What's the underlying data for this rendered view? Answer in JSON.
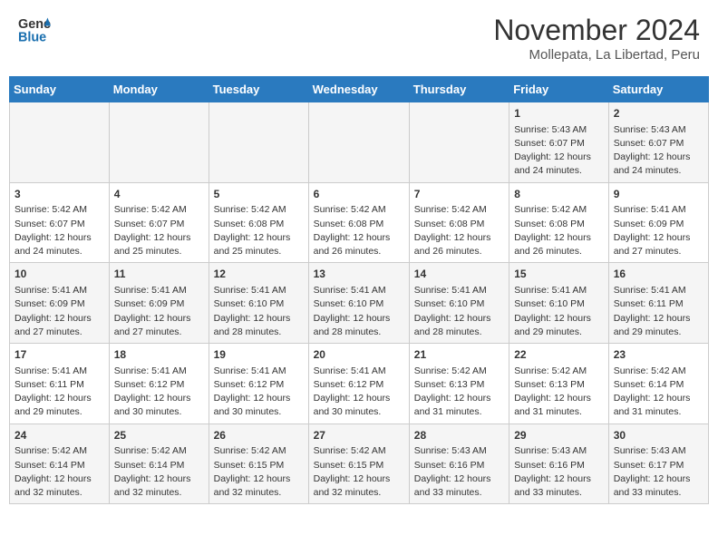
{
  "header": {
    "logo_line1": "General",
    "logo_line2": "Blue",
    "title": "November 2024",
    "subtitle": "Mollepata, La Libertad, Peru"
  },
  "days_of_week": [
    "Sunday",
    "Monday",
    "Tuesday",
    "Wednesday",
    "Thursday",
    "Friday",
    "Saturday"
  ],
  "weeks": [
    [
      {
        "day": "",
        "info": ""
      },
      {
        "day": "",
        "info": ""
      },
      {
        "day": "",
        "info": ""
      },
      {
        "day": "",
        "info": ""
      },
      {
        "day": "",
        "info": ""
      },
      {
        "day": "1",
        "info": "Sunrise: 5:43 AM\nSunset: 6:07 PM\nDaylight: 12 hours and 24 minutes."
      },
      {
        "day": "2",
        "info": "Sunrise: 5:43 AM\nSunset: 6:07 PM\nDaylight: 12 hours and 24 minutes."
      }
    ],
    [
      {
        "day": "3",
        "info": "Sunrise: 5:42 AM\nSunset: 6:07 PM\nDaylight: 12 hours and 24 minutes."
      },
      {
        "day": "4",
        "info": "Sunrise: 5:42 AM\nSunset: 6:07 PM\nDaylight: 12 hours and 25 minutes."
      },
      {
        "day": "5",
        "info": "Sunrise: 5:42 AM\nSunset: 6:08 PM\nDaylight: 12 hours and 25 minutes."
      },
      {
        "day": "6",
        "info": "Sunrise: 5:42 AM\nSunset: 6:08 PM\nDaylight: 12 hours and 26 minutes."
      },
      {
        "day": "7",
        "info": "Sunrise: 5:42 AM\nSunset: 6:08 PM\nDaylight: 12 hours and 26 minutes."
      },
      {
        "day": "8",
        "info": "Sunrise: 5:42 AM\nSunset: 6:08 PM\nDaylight: 12 hours and 26 minutes."
      },
      {
        "day": "9",
        "info": "Sunrise: 5:41 AM\nSunset: 6:09 PM\nDaylight: 12 hours and 27 minutes."
      }
    ],
    [
      {
        "day": "10",
        "info": "Sunrise: 5:41 AM\nSunset: 6:09 PM\nDaylight: 12 hours and 27 minutes."
      },
      {
        "day": "11",
        "info": "Sunrise: 5:41 AM\nSunset: 6:09 PM\nDaylight: 12 hours and 27 minutes."
      },
      {
        "day": "12",
        "info": "Sunrise: 5:41 AM\nSunset: 6:10 PM\nDaylight: 12 hours and 28 minutes."
      },
      {
        "day": "13",
        "info": "Sunrise: 5:41 AM\nSunset: 6:10 PM\nDaylight: 12 hours and 28 minutes."
      },
      {
        "day": "14",
        "info": "Sunrise: 5:41 AM\nSunset: 6:10 PM\nDaylight: 12 hours and 28 minutes."
      },
      {
        "day": "15",
        "info": "Sunrise: 5:41 AM\nSunset: 6:10 PM\nDaylight: 12 hours and 29 minutes."
      },
      {
        "day": "16",
        "info": "Sunrise: 5:41 AM\nSunset: 6:11 PM\nDaylight: 12 hours and 29 minutes."
      }
    ],
    [
      {
        "day": "17",
        "info": "Sunrise: 5:41 AM\nSunset: 6:11 PM\nDaylight: 12 hours and 29 minutes."
      },
      {
        "day": "18",
        "info": "Sunrise: 5:41 AM\nSunset: 6:12 PM\nDaylight: 12 hours and 30 minutes."
      },
      {
        "day": "19",
        "info": "Sunrise: 5:41 AM\nSunset: 6:12 PM\nDaylight: 12 hours and 30 minutes."
      },
      {
        "day": "20",
        "info": "Sunrise: 5:41 AM\nSunset: 6:12 PM\nDaylight: 12 hours and 30 minutes."
      },
      {
        "day": "21",
        "info": "Sunrise: 5:42 AM\nSunset: 6:13 PM\nDaylight: 12 hours and 31 minutes."
      },
      {
        "day": "22",
        "info": "Sunrise: 5:42 AM\nSunset: 6:13 PM\nDaylight: 12 hours and 31 minutes."
      },
      {
        "day": "23",
        "info": "Sunrise: 5:42 AM\nSunset: 6:14 PM\nDaylight: 12 hours and 31 minutes."
      }
    ],
    [
      {
        "day": "24",
        "info": "Sunrise: 5:42 AM\nSunset: 6:14 PM\nDaylight: 12 hours and 32 minutes."
      },
      {
        "day": "25",
        "info": "Sunrise: 5:42 AM\nSunset: 6:14 PM\nDaylight: 12 hours and 32 minutes."
      },
      {
        "day": "26",
        "info": "Sunrise: 5:42 AM\nSunset: 6:15 PM\nDaylight: 12 hours and 32 minutes."
      },
      {
        "day": "27",
        "info": "Sunrise: 5:42 AM\nSunset: 6:15 PM\nDaylight: 12 hours and 32 minutes."
      },
      {
        "day": "28",
        "info": "Sunrise: 5:43 AM\nSunset: 6:16 PM\nDaylight: 12 hours and 33 minutes."
      },
      {
        "day": "29",
        "info": "Sunrise: 5:43 AM\nSunset: 6:16 PM\nDaylight: 12 hours and 33 minutes."
      },
      {
        "day": "30",
        "info": "Sunrise: 5:43 AM\nSunset: 6:17 PM\nDaylight: 12 hours and 33 minutes."
      }
    ]
  ]
}
